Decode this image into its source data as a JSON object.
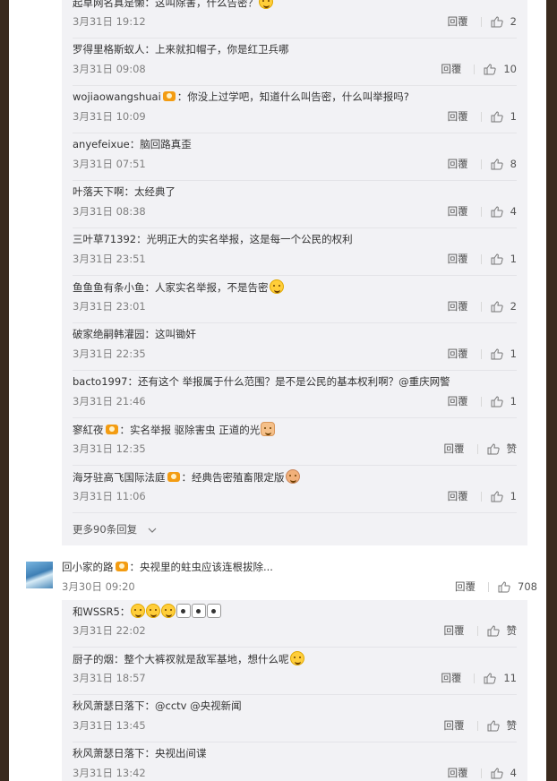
{
  "group1": {
    "replies": [
      {
        "user": "起草网名真是懒",
        "badge": false,
        "text": "：这叫除害，什么告密？",
        "emoji": "smile",
        "time": "3月31日 19:12",
        "like_label": "2"
      },
      {
        "user": "罗得里格斯蚁人",
        "badge": false,
        "text": "：上来就扣帽子，你是红卫兵哪",
        "emoji": "",
        "time": "3月31日 09:08",
        "like_label": "10"
      },
      {
        "user": "wojiaowangshuai",
        "badge": true,
        "text": "：你没上过学吧，知道什么叫告密，什么叫举报吗?",
        "emoji": "",
        "time": "3月31日 10:09",
        "like_label": "1"
      },
      {
        "user": "anyefeixue",
        "badge": false,
        "text": "：脑回路真歪",
        "emoji": "",
        "time": "3月31日 07:51",
        "like_label": "8"
      },
      {
        "user": "叶落天下啊",
        "badge": false,
        "text": "：太经典了",
        "emoji": "",
        "time": "3月31日 08:38",
        "like_label": "4"
      },
      {
        "user": "三叶草71392",
        "badge": false,
        "text": "：光明正大的实名举报，这是每一个公民的权利",
        "emoji": "",
        "time": "3月31日 23:51",
        "like_label": "1"
      },
      {
        "user": "鱼鱼鱼有条小鱼",
        "badge": false,
        "text": "：人家实名举报，不是告密",
        "emoji": "grin",
        "time": "3月31日 23:01",
        "like_label": "2"
      },
      {
        "user": "破家绝嗣韩灌园",
        "badge": false,
        "text": "：这叫锄奸",
        "emoji": "",
        "time": "3月31日 22:35",
        "like_label": "1"
      },
      {
        "user": "bacto1997",
        "badge": false,
        "text": "：还有这个 举报属于什么范围？是不是公民的基本权利啊？@重庆网警",
        "emoji": "",
        "time": "3月31日 21:46",
        "like_label": "1"
      },
      {
        "user": "寥紅夜",
        "badge": true,
        "text": "：实名举报 驱除害虫 正道的光",
        "emoji": "thumbsup",
        "time": "3月31日 12:35",
        "like_label": "赞"
      },
      {
        "user": "海牙驻高飞国际法庭",
        "badge": true,
        "text": "：经典告密殖畜限定版",
        "emoji": "face",
        "time": "3月31日 11:06",
        "like_label": "1"
      }
    ],
    "more_label": "更多90条回复"
  },
  "main_comment": {
    "user": "回小家的路",
    "badge": true,
    "text": "：央视里的蛀虫应该连根拔除...",
    "time": "3月30日 09:20",
    "reply_label": "回覆",
    "like_label": "708"
  },
  "group2": {
    "replies": [
      {
        "user": "和WSSR5",
        "badge": false,
        "text": "：",
        "emoji": "multi",
        "time": "3月31日 22:02",
        "like_label": "赞"
      },
      {
        "user": "厨子的烟",
        "badge": false,
        "text": "：整个大裤衩就是敌军基地，想什么呢",
        "emoji": "smirk",
        "time": "3月31日 18:57",
        "like_label": "11"
      },
      {
        "user": "秋风萧瑟日落下",
        "badge": false,
        "text": "：@cctv @央视新闻",
        "emoji": "",
        "time": "3月31日 13:45",
        "like_label": "赞"
      },
      {
        "user": "秋风萧瑟日落下",
        "badge": false,
        "text": "：央视出间谍",
        "emoji": "",
        "time": "3月31日 13:42",
        "like_label": "4"
      }
    ]
  },
  "reply_label": "回覆",
  "icons": {
    "like": "thumbs-up-icon",
    "badge": "vip-badge-icon",
    "expand": "chevron-down-icon"
  },
  "colors": {
    "time": "#808080",
    "reply_bg": "#f2f2f5",
    "badge": "#f39c12"
  }
}
